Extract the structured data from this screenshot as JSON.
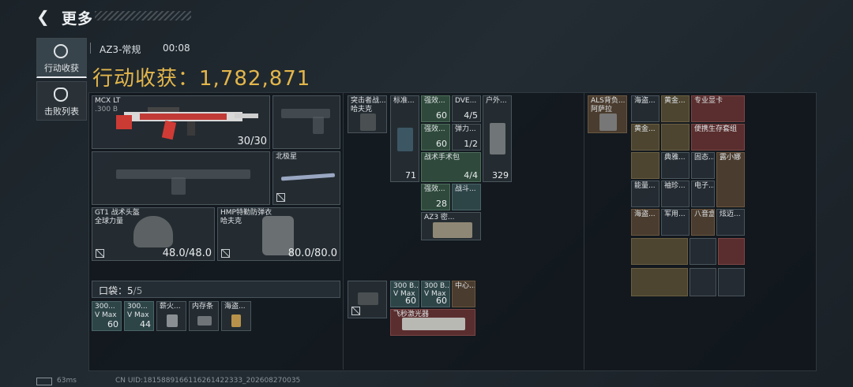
{
  "header": {
    "back_icon": "chevron-left-icon",
    "title": "更多"
  },
  "sidebar": {
    "tabs": [
      {
        "label": "行动收获",
        "icon": "target-icon",
        "active": true
      },
      {
        "label": "击败列表",
        "icon": "skull-icon",
        "active": false
      }
    ]
  },
  "match": {
    "mode": "AZ3-常规",
    "time": "00:08"
  },
  "harvest": {
    "label": "行动收获：",
    "value": "1,782,871",
    "color": "#e3b64b"
  },
  "equipment": {
    "primary": {
      "name": "MCX LT",
      "ammo_type": ".300 B",
      "ammo": "30/30"
    },
    "melee": {
      "name": "北极星"
    },
    "helmet": {
      "name": "GT1 战术头盔",
      "brand": "全球力量",
      "durability": "48.0/48.0"
    },
    "armor": {
      "name": "HMP特勤防弹衣",
      "brand": "哈夫克",
      "durability": "80.0/80.0"
    }
  },
  "pocket": {
    "label": "口袋：",
    "used": "5",
    "total": "/5",
    "items": [
      {
        "label": "300...",
        "sub": "V Max",
        "count": "60"
      },
      {
        "label": "300...",
        "sub": "V Max",
        "count": "44"
      },
      {
        "label": "薪火...",
        "count": ""
      },
      {
        "label": "内存条",
        "count": ""
      },
      {
        "label": "海盗...",
        "count": ""
      }
    ]
  },
  "chest_rig": {
    "items": [
      {
        "label": "突击者战...",
        "sub": "哈夫克"
      }
    ]
  },
  "backpack": {
    "items": [
      {
        "label": "标准...",
        "count": "71"
      },
      {
        "label": "强效...",
        "count": "60"
      },
      {
        "label": "DVE...",
        "count": "4/5"
      },
      {
        "label": "户外...",
        "count": "329"
      },
      {
        "label": "强效...",
        "count": "60"
      },
      {
        "label": "弹力...",
        "count": "1/2"
      },
      {
        "label": "战术手术包",
        "count": "4/4"
      },
      {
        "label": "强效...",
        "count": "28"
      },
      {
        "label": "战斗...",
        "count": ""
      },
      {
        "label": "AZ3 密...",
        "count": ""
      }
    ]
  },
  "case": {
    "items": [
      {
        "label": "300 B...",
        "sub": "V Max",
        "count": "60"
      },
      {
        "label": "300 B...",
        "sub": "V Max",
        "count": "60"
      },
      {
        "label": "中心...",
        "count": ""
      },
      {
        "label": "飞秒激光器",
        "count": ""
      }
    ]
  },
  "loot_bag": {
    "label": "ALS背负...",
    "sub": "阿萨拉"
  },
  "loot": {
    "items": [
      {
        "label": "海盗..."
      },
      {
        "label": "黄金..."
      },
      {
        "label": "专业显卡"
      },
      {
        "label": "黄金..."
      },
      {
        "label": "便携生存套组"
      },
      {
        "label": "典雅..."
      },
      {
        "label": "固态..."
      },
      {
        "label": "露小娜"
      },
      {
        "label": "能量..."
      },
      {
        "label": "袖珍..."
      },
      {
        "label": "电子..."
      },
      {
        "label": "海盗..."
      },
      {
        "label": "军用..."
      },
      {
        "label": "八音盒"
      },
      {
        "label": "炫迈..."
      }
    ]
  },
  "footer": {
    "ping": "63ms",
    "uid": "CN UID:1815889166116261422333_202608270035"
  },
  "colors": {
    "gold": "#e3b64b",
    "green_cell": "#2f4a3c",
    "brown_cell": "#4a3c2e",
    "red_cell": "#5a2e2e"
  }
}
